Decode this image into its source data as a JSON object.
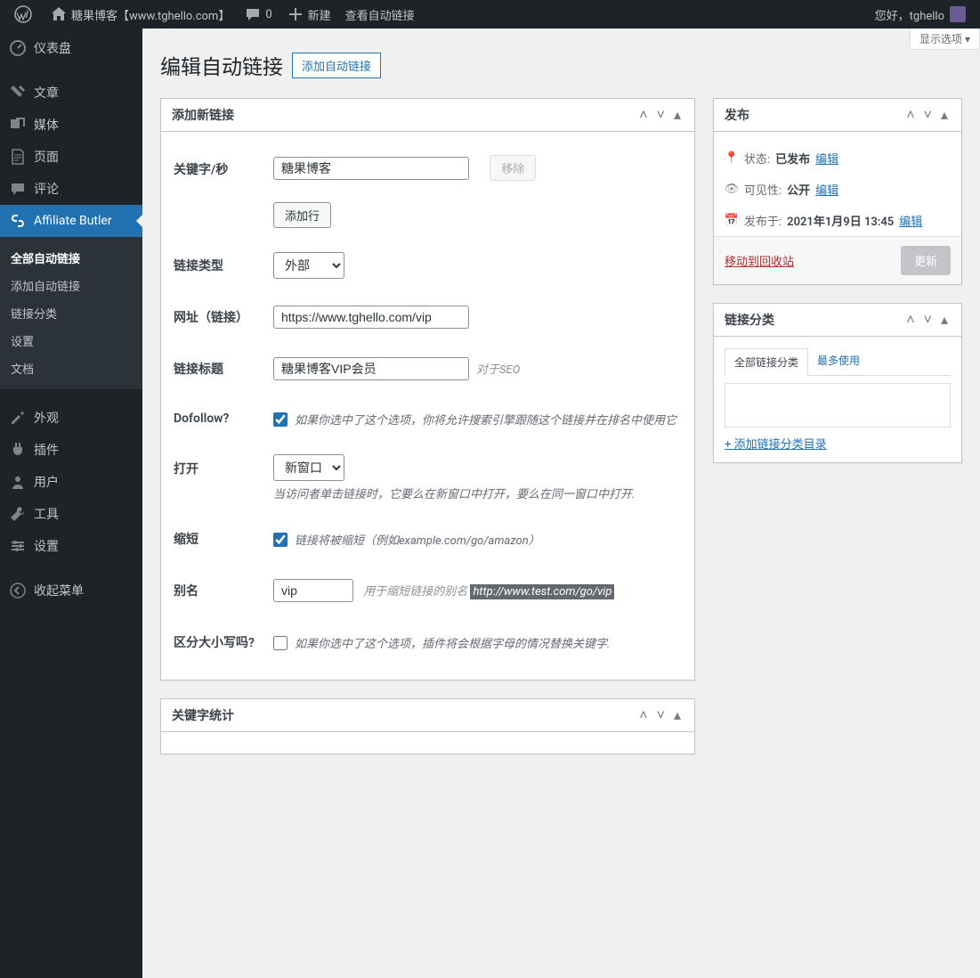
{
  "toolbar": {
    "site_name": "糖果博客【www.tghello.com】",
    "comments": "0",
    "new_label": "新建",
    "view_label": "查看自动链接",
    "greeting": "您好，tghello"
  },
  "screen_options": "显示选项 ▾",
  "sidebar": {
    "items": [
      {
        "icon": "dashboard",
        "label": "仪表盘"
      },
      {
        "icon": "pin",
        "label": "文章"
      },
      {
        "icon": "media",
        "label": "媒体"
      },
      {
        "icon": "page",
        "label": "页面"
      },
      {
        "icon": "comment",
        "label": "评论"
      },
      {
        "icon": "link",
        "label": "Affiliate Butler"
      },
      {
        "icon": "appearance",
        "label": "外观"
      },
      {
        "icon": "plugin",
        "label": "插件"
      },
      {
        "icon": "user",
        "label": "用户"
      },
      {
        "icon": "tool",
        "label": "工具"
      },
      {
        "icon": "settings",
        "label": "设置"
      },
      {
        "icon": "collapse",
        "label": "收起菜单"
      }
    ],
    "submenu": [
      "全部自动链接",
      "添加自动链接",
      "链接分类",
      "设置",
      "文档"
    ]
  },
  "page": {
    "title": "编辑自动链接",
    "action": "添加自动链接"
  },
  "form": {
    "box_title": "添加新链接",
    "keywords_label": "关键字/秒",
    "keywords_value": "糖果博客",
    "remove_btn": "移除",
    "addrow_btn": "添加行",
    "linktype_label": "链接类型",
    "linktype_value": "外部",
    "url_label": "网址（链接）",
    "url_value": "https://www.tghello.com/vip",
    "title_label": "链接标题",
    "title_value": "糖果博客VIP会员",
    "title_desc": "对于SEO",
    "dofollow_label": "Dofollow?",
    "dofollow_desc": "如果你选中了这个选项，你将允许搜索引擎跟随这个链接并在排名中使用它",
    "open_label": "打开",
    "open_value": "新窗口",
    "open_desc": "当访问者单击链接时，它要么在新窗口中打开，要么在同一窗口中打开.",
    "shorten_label": "缩短",
    "shorten_desc": "链接将被缩短（例如example.com/go/amazon）",
    "alias_label": "别名",
    "alias_value": "vip",
    "alias_desc": "用于缩短链接的别名",
    "alias_example": "http://www.test.com/go/vip",
    "case_label": "区分大小写吗?",
    "case_desc": "如果你选中了这个选项，插件将会根据字母的情况替换关键字.",
    "stats_title": "关键字统计"
  },
  "publish": {
    "title": "发布",
    "status_label": "状态:",
    "status_value": "已发布",
    "visibility_label": "可见性:",
    "visibility_value": "公开",
    "date_label": "发布于:",
    "date_value": "2021年1月9日 13:45",
    "edit": "编辑",
    "trash": "移动到回收站",
    "update": "更新"
  },
  "categories": {
    "title": "链接分类",
    "tab_all": "全部链接分类",
    "tab_most": "最多使用",
    "add_link": "+ 添加链接分类目录"
  }
}
